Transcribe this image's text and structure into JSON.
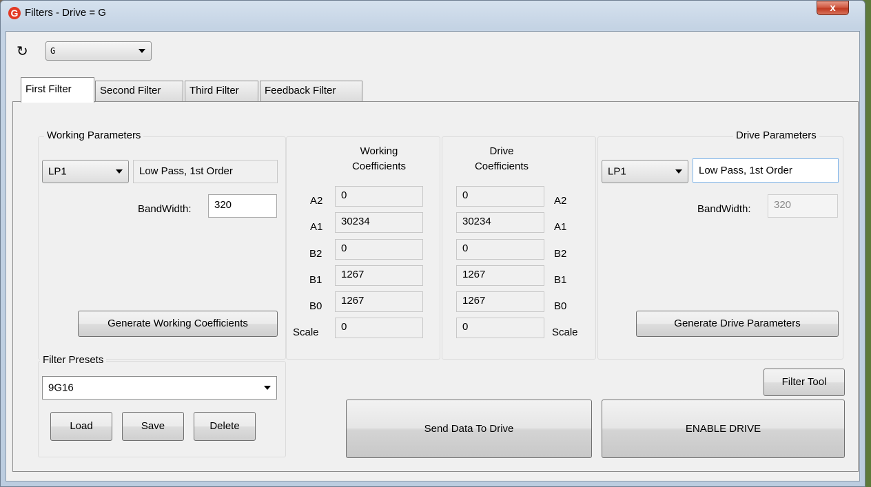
{
  "window": {
    "title": "Filters - Drive = G",
    "logo": "G",
    "close_label": "x"
  },
  "toolbar": {
    "refresh_icon": "↻",
    "drive_value": "G"
  },
  "tabs": [
    {
      "label": "First Filter",
      "active": true
    },
    {
      "label": "Second Filter",
      "active": false
    },
    {
      "label": "Third Filter",
      "active": false
    },
    {
      "label": "Feedback Filter",
      "active": false
    }
  ],
  "working": {
    "title": "Working Parameters",
    "filter_type": "LP1",
    "filter_desc": "Low Pass, 1st Order",
    "bandwidth_label": "BandWidth:",
    "bandwidth_value": "320",
    "generate_label": "Generate Working Coefficients"
  },
  "working_coeffs": {
    "header": [
      "Working",
      "Coefficients"
    ],
    "rows": [
      {
        "label": "A2",
        "value": "0"
      },
      {
        "label": "A1",
        "value": "30234"
      },
      {
        "label": "B2",
        "value": "0"
      },
      {
        "label": "B1",
        "value": "1267"
      },
      {
        "label": "B0",
        "value": "1267"
      },
      {
        "label": "Scale",
        "value": "0"
      }
    ]
  },
  "drive_coeffs": {
    "header": [
      "Drive",
      "Coefficients"
    ],
    "rows": [
      {
        "label": "A2",
        "value": "0"
      },
      {
        "label": "A1",
        "value": "30234"
      },
      {
        "label": "B2",
        "value": "0"
      },
      {
        "label": "B1",
        "value": "1267"
      },
      {
        "label": "B0",
        "value": "1267"
      },
      {
        "label": "Scale",
        "value": "0"
      }
    ]
  },
  "drive": {
    "title": "Drive Parameters",
    "filter_type": "LP1",
    "filter_desc": "Low Pass, 1st Order",
    "bandwidth_label": "BandWidth:",
    "bandwidth_value": "320",
    "generate_label": "Generate Drive Parameters"
  },
  "presets": {
    "title": "Filter Presets",
    "selected": "9G16",
    "load_label": "Load",
    "save_label": "Save",
    "delete_label": "Delete"
  },
  "actions": {
    "filter_tool_label": "Filter Tool",
    "send_label": "Send Data To Drive",
    "enable_label": "ENABLE DRIVE"
  }
}
